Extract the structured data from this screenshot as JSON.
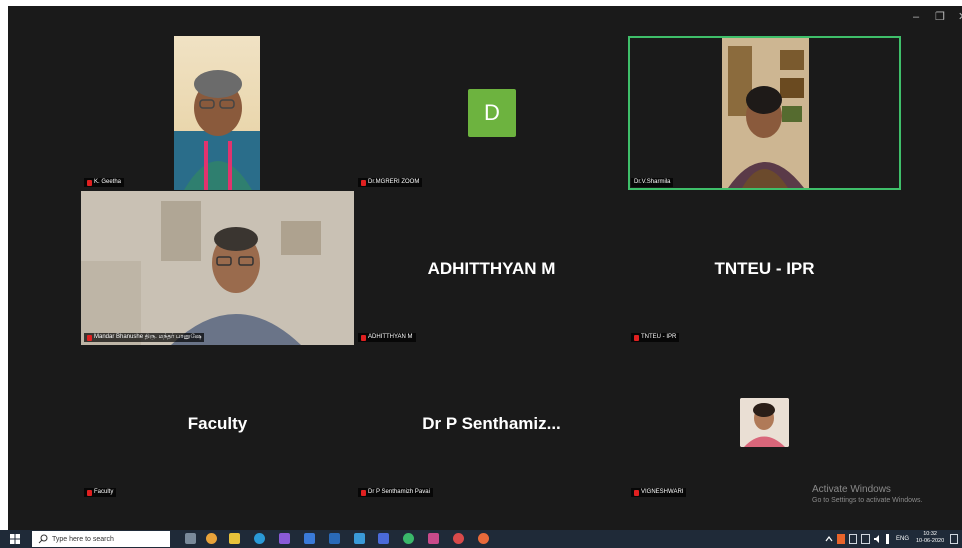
{
  "window": {
    "min_glyph": "–",
    "restore_glyph": "❐",
    "close_glyph": "✕"
  },
  "participants": [
    {
      "name": "K. Geetha"
    },
    {
      "name": "Dr.MGRERI ZOOM",
      "avatar_letter": "D",
      "avatar_color": "#6db33f"
    },
    {
      "name": "Dr.V.Sharmila",
      "active_speaker": true
    },
    {
      "name": "Mandar Bhanushe திரு. மந்தர் பானுஷே"
    },
    {
      "name": "ADHITTHYAN M",
      "display": "ADHITTHYAN M"
    },
    {
      "name": "TNTEU - IPR",
      "display": "TNTEU - IPR"
    },
    {
      "name": "Faculty",
      "display": "Faculty"
    },
    {
      "name": "Dr P Senthamizh Pavai",
      "display": "Dr P Senthamiz..."
    },
    {
      "name": "VIGNESHWARI"
    }
  ],
  "watermark": {
    "title": "Activate Windows",
    "subtitle": "Go to Settings to activate Windows."
  },
  "taskbar": {
    "search_placeholder": "Type here to search",
    "tray": {
      "language": "ENG",
      "time": "10:32",
      "date": "10-06-2020"
    }
  },
  "colors": {
    "active_border": "#3fbf6a",
    "zoom_bg": "#1a1a1a",
    "taskbar_bg": "#1f2a38"
  }
}
